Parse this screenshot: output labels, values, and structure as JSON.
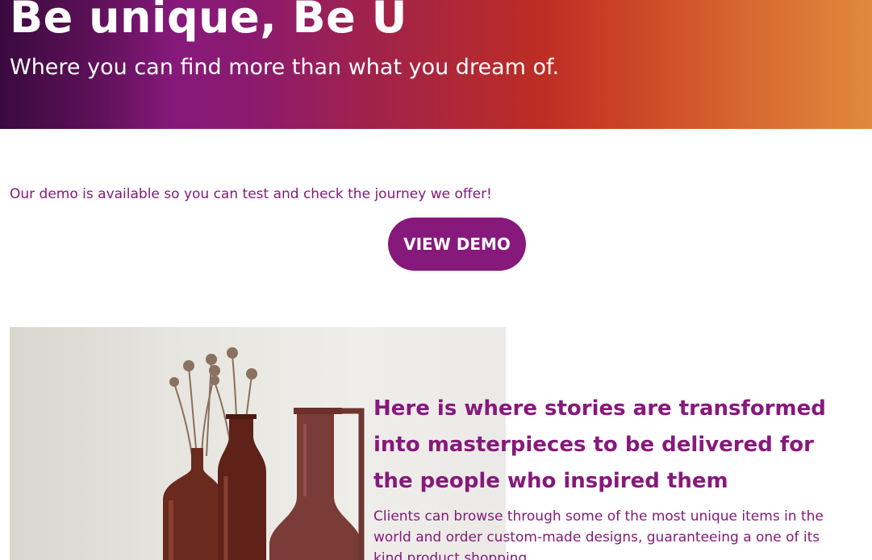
{
  "hero": {
    "title": "Be unique, Be U",
    "subtitle": "Where you can find more than what you dream of."
  },
  "demo": {
    "text": "Our demo is available so you can test and check the journey we offer!",
    "button_label": "VIEW DEMO"
  },
  "feature": {
    "heading": "Here is where stories are transformed into masterpieces to be delivered for the people who inspired them",
    "body": "Clients can browse through some of the most unique items in the world and order custom-made designs, guaranteeing a one of its kind product shopping."
  },
  "colors": {
    "brand_purple": "#86197b",
    "gradient_start": "#3a0a3f",
    "gradient_mid": "#bd2d24",
    "gradient_end": "#e0893d"
  }
}
